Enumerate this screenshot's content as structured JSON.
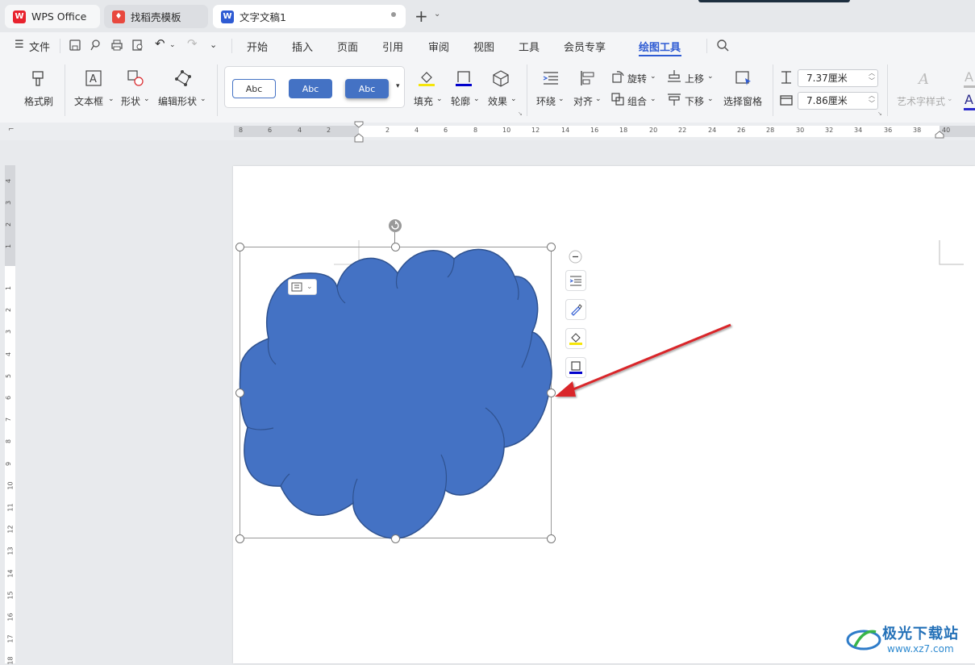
{
  "tabs": [
    {
      "label": "WPS Office"
    },
    {
      "label": "找稻壳模板"
    },
    {
      "label": "文字文稿1"
    }
  ],
  "menu": {
    "file": "文件",
    "items": [
      "开始",
      "插入",
      "页面",
      "引用",
      "审阅",
      "视图",
      "工具",
      "会员专享",
      "绘图工具"
    ]
  },
  "toolbar": {
    "format_brush": "格式刷",
    "textbox": "文本框",
    "shape": "形状",
    "edit_shape": "编辑形状",
    "style_samples": [
      "Abc",
      "Abc",
      "Abc"
    ],
    "fill": "填充",
    "outline": "轮廓",
    "effect": "效果",
    "wrap": "环绕",
    "align": "对齐",
    "rotate": "旋转",
    "group": "组合",
    "move_up": "上移",
    "move_down": "下移",
    "selection_pane": "选择窗格",
    "height_value": "7.37厘米",
    "width_value": "7.86厘米",
    "art_text_style": "艺术字样式"
  },
  "ruler": {
    "h_ticks": [
      "8",
      "6",
      "4",
      "2",
      "2",
      "4",
      "6",
      "8",
      "10",
      "12",
      "14",
      "16",
      "18",
      "20",
      "22",
      "24",
      "26",
      "28",
      "30",
      "32",
      "34",
      "36",
      "38",
      "40"
    ],
    "v_ticks_top": [
      "4",
      "3",
      "2",
      "1"
    ],
    "v_ticks": [
      "1",
      "2",
      "3",
      "4",
      "5",
      "6",
      "7",
      "8",
      "9",
      "10",
      "11",
      "12",
      "13",
      "14",
      "15",
      "16",
      "17",
      "18"
    ]
  },
  "watermark": {
    "name": "极光下载站",
    "url": "www.xz7.com"
  },
  "colors": {
    "shape_fill": "#4472c4",
    "shape_stroke": "#2f528f",
    "accent": "#2e5bd3",
    "arrow": "#d9252a"
  }
}
